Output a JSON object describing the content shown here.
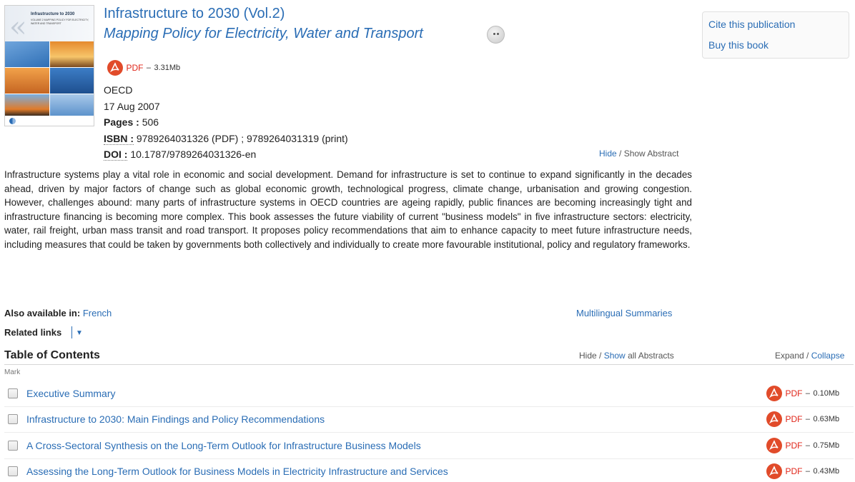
{
  "cover": {
    "title": "Infrastructure to 2030",
    "subtitle": "VOLUME 2 MAPPING POLICY FOR ELECTRICITY, WATER AND TRANSPORT",
    "logo_text": "OECD"
  },
  "publication": {
    "title": "Infrastructure to 2030 (Vol.2)",
    "subtitle": "Mapping Policy for Electricity, Water and Transport",
    "pdf": {
      "label": "PDF",
      "dash": "–",
      "size": "3.31Mb"
    },
    "publisher": "OECD",
    "date": "17 Aug 2007",
    "pages_label": "Pages :",
    "pages": "506",
    "isbn_label": "ISBN :",
    "isbn": "9789264031326 (PDF) ; 9789264031319 (print)",
    "doi_label": "DOI :",
    "doi": "10.1787/9789264031326-en",
    "abstract_toggle": {
      "hide": "Hide",
      "sep": " / ",
      "show": "Show Abstract"
    },
    "abstract": "Infrastructure systems play a vital role in economic and social development. Demand for infrastructure is set to continue to expand significantly in the decades ahead, driven by major factors of change such as global economic growth, technological progress, climate change, urbanisation and growing congestion. However, challenges abound: many parts of infrastructure systems in OECD countries are ageing rapidly, public finances are becoming increasingly tight and infrastructure financing is becoming more complex. This book assesses the future viability of current \"business models\" in five infrastructure sectors: electricity, water, rail freight, urban mass transit and road transport. It proposes policy recommendations that aim to enhance capacity to meet future infrastructure needs, including measures that could be taken by governments both collectively and individually to create more favourable institutional, policy and regulatory frameworks."
  },
  "sidebar": {
    "cite": "Cite this publication",
    "buy": "Buy this book"
  },
  "links": {
    "also_label": "Also available in:",
    "also_lang": "French",
    "multilingual": "Multilingual Summaries",
    "related": "Related links"
  },
  "toc": {
    "title": "Table of Contents",
    "hide": "Hide",
    "sep": " / ",
    "show_all": "Show",
    "all_abstracts": " all Abstracts",
    "expand": "Expand",
    "expand_sep": " / ",
    "collapse": "Collapse",
    "mark": "Mark",
    "items": [
      {
        "title": "Executive Summary",
        "pdf": "PDF",
        "dash": "–",
        "size": "0.10Mb"
      },
      {
        "title": "Infrastructure to 2030: Main Findings and Policy Recommendations",
        "pdf": "PDF",
        "dash": "–",
        "size": "0.63Mb"
      },
      {
        "title": "A Cross-Sectoral Synthesis on the Long-Term Outlook for Infrastructure Business Models",
        "pdf": "PDF",
        "dash": "–",
        "size": "0.75Mb"
      },
      {
        "title": "Assessing the Long-Term Outlook for Business Models in Electricity Infrastructure and Services",
        "pdf": "PDF",
        "dash": "–",
        "size": "0.43Mb"
      }
    ]
  },
  "colors": {
    "link": "#2a6db5",
    "pdf_red": "#e0261a",
    "pdf_icon": "#e14b2a",
    "text": "#222222"
  }
}
